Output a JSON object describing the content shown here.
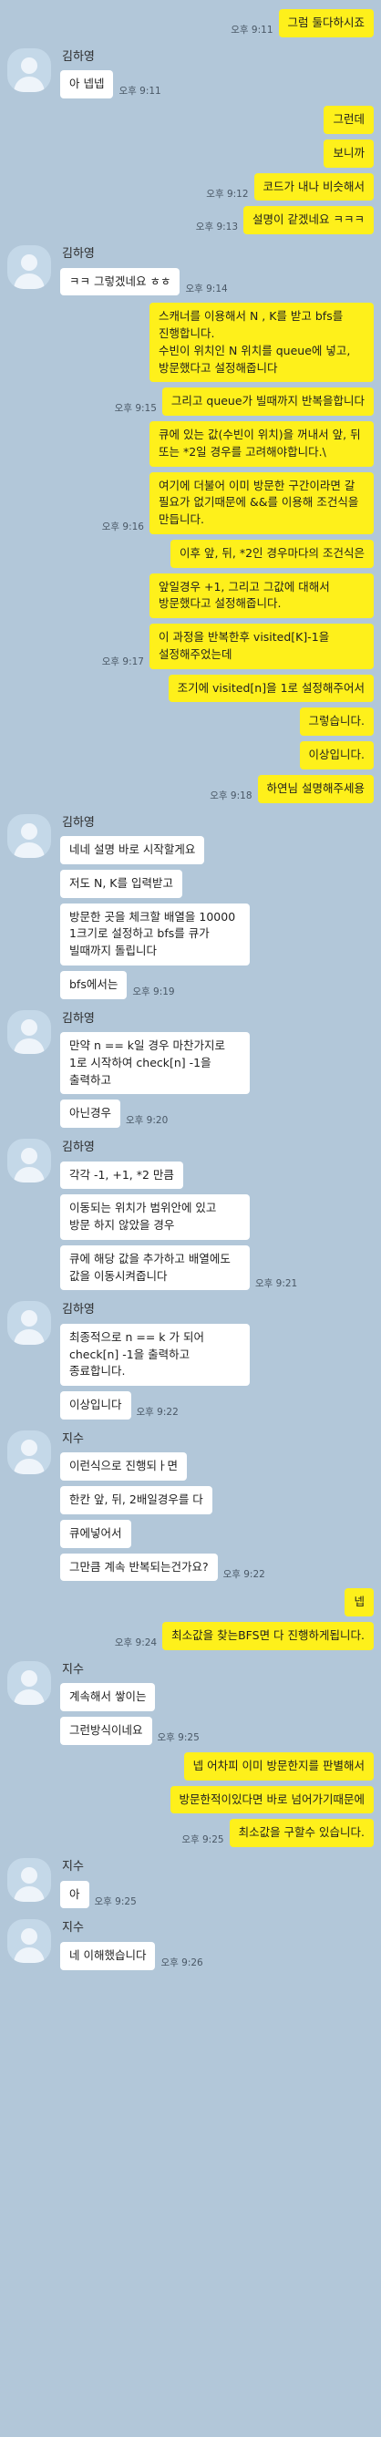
{
  "chat": {
    "blocks": [
      {
        "side": "me",
        "msgs": [
          {
            "text": "그럼 둘다하시죠",
            "time": "오후 9:11"
          }
        ]
      },
      {
        "side": "other",
        "sender": "김하영",
        "msgs": [
          {
            "text": "아 넵넵",
            "time": "오후 9:11"
          }
        ]
      },
      {
        "side": "me",
        "msgs": [
          {
            "text": "그런데",
            "time": ""
          },
          {
            "text": "보니까",
            "time": ""
          },
          {
            "text": "코드가 내나 비슷해서",
            "time": "오후 9:12"
          },
          {
            "text": "설명이 같겠네요 ㅋㅋㅋ",
            "time": "오후 9:13"
          }
        ]
      },
      {
        "side": "other",
        "sender": "김하영",
        "msgs": [
          {
            "text": "ㅋㅋ 그렇겠네요 ㅎㅎ",
            "time": "오후 9:14"
          }
        ]
      },
      {
        "side": "me",
        "msgs": [
          {
            "text": "스캐너를 이용해서 N , K를 받고 bfs를 진행합니다.\n수빈이 위치인 N 위치를 queue에 넣고, 방문했다고 설정해줍니다",
            "time": ""
          },
          {
            "text": "그리고 queue가 빌때까지 반복을합니다",
            "time": "오후 9:15"
          },
          {
            "text": "큐에 있는 값(수빈이 위치)을 꺼내서 앞, 뒤 또는 *2일 경우를 고려해야합니다.\\",
            "time": ""
          },
          {
            "text": "여기에 더불어 이미 방문한 구간이라면 갈 필요가 없기때문에 &&를 이용해 조건식을 만듭니다.",
            "time": "오후 9:16"
          },
          {
            "text": "이후 앞, 뒤, *2인 경우마다의 조건식은",
            "time": ""
          },
          {
            "text": "앞일경우 +1, 그리고 그값에 대해서 방문했다고 설정해줍니다.",
            "time": ""
          },
          {
            "text": "이 과정을 반복한후 visited[K]-1을 설정해주었는데",
            "time": "오후 9:17"
          },
          {
            "text": "조기에 visited[n]을 1로 설정해주어서",
            "time": ""
          },
          {
            "text": "그렇습니다.",
            "time": ""
          },
          {
            "text": "이상입니다.",
            "time": ""
          },
          {
            "text": "하연님 설명해주세용",
            "time": "오후 9:18"
          }
        ]
      },
      {
        "side": "other",
        "sender": "김하영",
        "msgs": [
          {
            "text": "네네 설명 바로 시작할게요",
            "time": ""
          },
          {
            "text": "저도 N, K를 입력받고",
            "time": ""
          },
          {
            "text": "방문한 곳을 체크할 배열을 10000 1크기로 설정하고 bfs를 큐가 빌때까지 돌립니다",
            "time": ""
          },
          {
            "text": "bfs에서는",
            "time": "오후 9:19"
          }
        ]
      },
      {
        "side": "other",
        "sender": "김하영",
        "msgs": [
          {
            "text": "만약 n == k일 경우 마찬가지로 1로 시작하여 check[n] -1을 출력하고",
            "time": ""
          },
          {
            "text": "아닌경우",
            "time": "오후 9:20"
          }
        ]
      },
      {
        "side": "other",
        "sender": "김하영",
        "msgs": [
          {
            "text": "각각 -1, +1, *2 만큼",
            "time": ""
          },
          {
            "text": "이동되는 위치가 범위안에 있고 방문 하지 않았을 경우",
            "time": ""
          },
          {
            "text": "큐에 해당 값을 추가하고 배열에도 값을 이동시켜줍니다",
            "time": "오후 9:21"
          }
        ]
      },
      {
        "side": "other",
        "sender": "김하영",
        "msgs": [
          {
            "text": "최종적으로 n == k 가 되어 check[n] -1을 출력하고 종료합니다.",
            "time": ""
          },
          {
            "text": "이상입니다",
            "time": "오후 9:22"
          }
        ]
      },
      {
        "side": "other",
        "sender": "지수",
        "msgs": [
          {
            "text": "이런식으로 진행되ㅏ면",
            "time": ""
          },
          {
            "text": "한칸 앞, 뒤, 2배일경우를 다",
            "time": ""
          },
          {
            "text": "큐에넣어서",
            "time": ""
          },
          {
            "text": "그만큼 계속 반복되는건가요?",
            "time": "오후 9:22"
          }
        ]
      },
      {
        "side": "me",
        "msgs": [
          {
            "text": "넵",
            "time": ""
          },
          {
            "text": "최소값을 찾는BFS면 다 진행하게됩니다.",
            "time": "오후 9:24"
          }
        ]
      },
      {
        "side": "other",
        "sender": "지수",
        "msgs": [
          {
            "text": "계속해서 쌓이는",
            "time": ""
          },
          {
            "text": "그런방식이네요",
            "time": "오후 9:25"
          }
        ]
      },
      {
        "side": "me",
        "msgs": [
          {
            "text": "넵 어차피 이미 방문한지를 판별해서",
            "time": ""
          },
          {
            "text": "방문한적이있다면 바로 넘어가기때문에",
            "time": ""
          },
          {
            "text": "최소값을 구할수 있습니다.",
            "time": "오후 9:25"
          }
        ]
      },
      {
        "side": "other",
        "sender": "지수",
        "msgs": [
          {
            "text": "아",
            "time": "오후 9:25"
          }
        ]
      },
      {
        "side": "other",
        "sender": "지수",
        "msgs": [
          {
            "text": "네 이해했습니다",
            "time": "오후 9:26"
          }
        ]
      }
    ]
  }
}
